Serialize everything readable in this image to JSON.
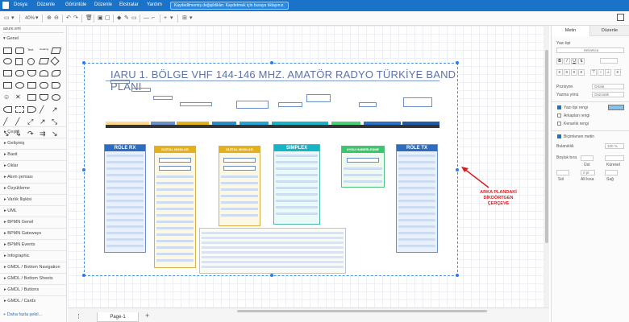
{
  "menu": {
    "items": [
      "Dosya",
      "Düzenle",
      "Görüntüle",
      "Düzenle",
      "Ekstralar",
      "Yardım"
    ],
    "notice": "Kaydedilmemiş değişiklikler. Kaydetmek için buraya tıklayınız."
  },
  "toolbar": {
    "zoom": "40%"
  },
  "sidebar": {
    "search_placeholder": "azure.xml",
    "general_label": "Genel",
    "libraries": [
      "Çeşitli",
      "Gelişmiş",
      "Basit",
      "Oklar",
      "Akım şeması",
      "Özyükleme",
      "Varlık İlişkisi",
      "UML",
      "BPMN Genel",
      "BPMN Gateways",
      "BPMN Events",
      "Infographic",
      "GMDL / Bottom Navigation",
      "GMDL / Bottom Sheets",
      "GMDL / Buttons",
      "GMDL / Cards"
    ],
    "more_shapes": "+ Daha fazla şekil..."
  },
  "pages": {
    "tab": "Page-1"
  },
  "right_panel": {
    "tabs": [
      "Metin",
      "Düzenle"
    ],
    "font_label": "Yazı tipi",
    "font_value": "Helvetica",
    "position_label": "Pozisyon",
    "position_value": "Ortala",
    "direction_label": "Yazma yönü",
    "direction_value": "Otomatik",
    "font_color_label": "Yazı tipi rengi",
    "bg_color_label": "Arkaplan rengi",
    "border_color_label": "Kenarlık rengi",
    "formatted_label": "Biçimlenen metin",
    "opacity_label": "Bulanıklık",
    "opacity_value": "100 %",
    "spacing_label": "Boşluk bıra",
    "top_label": "Üst",
    "global_label": "Küresel",
    "left_label": "Sol",
    "bottom_label": "Alt kısa",
    "right_label": "Sağ",
    "bottom_value": "0 pt",
    "font_color": "#7fc5ef"
  },
  "diagram": {
    "title": "IARU 1. BÖLGE VHF 144-146 MHZ. AMATÖR RADYO TÜRKİYE BAND PLANI",
    "columns": [
      "RÖLE RX",
      "DİJİTAL MODLAR",
      "DİJİTAL MODLAR",
      "SIMPLEX",
      "UYDU HABERLEŞME",
      "RÖLE TX"
    ]
  },
  "annotation": "ARKA PLANDAKİ DİKDÖRTGEN ÇERÇEVE"
}
